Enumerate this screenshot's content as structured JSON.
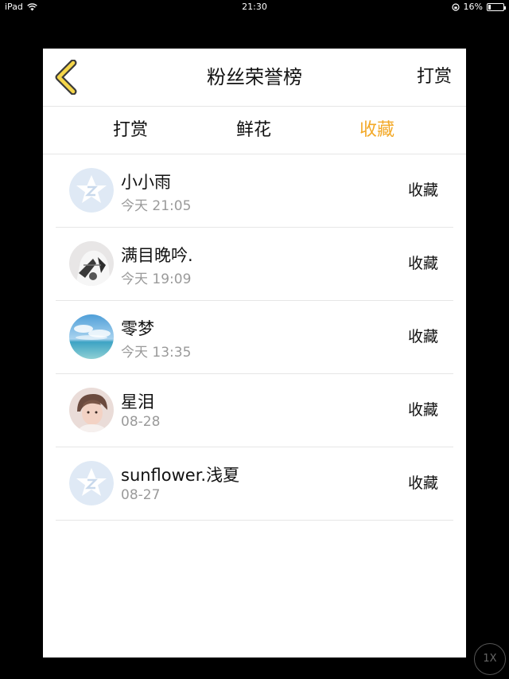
{
  "status_bar": {
    "device": "iPad",
    "time": "21:30",
    "battery": "16%",
    "battery_level": 0.16
  },
  "navbar": {
    "title": "粉丝荣誉榜",
    "right_action": "打赏"
  },
  "tabs": [
    {
      "label": "打赏",
      "active": false
    },
    {
      "label": "鲜花",
      "active": false
    },
    {
      "label": "收藏",
      "active": true
    }
  ],
  "colors": {
    "accent": "#f3a928",
    "secondary_text": "#9a9a9a",
    "divider": "#e6e6e6"
  },
  "fans": [
    {
      "name": "小小雨",
      "time": "今天 21:05",
      "action": "收藏",
      "avatar": "qq-default-icon"
    },
    {
      "name": "满目晚吟.",
      "time": "今天 19:09",
      "action": "收藏",
      "avatar": "photo-avatar"
    },
    {
      "name": "零梦",
      "time": "今天 13:35",
      "action": "收藏",
      "avatar": "sky-sea-avatar"
    },
    {
      "name": "星泪",
      "time": "08-28",
      "action": "收藏",
      "avatar": "portrait-avatar"
    },
    {
      "name": "sunflower.浅夏",
      "time": "08-27",
      "action": "收藏",
      "avatar": "qq-default-icon"
    }
  ],
  "zoom": "1X"
}
